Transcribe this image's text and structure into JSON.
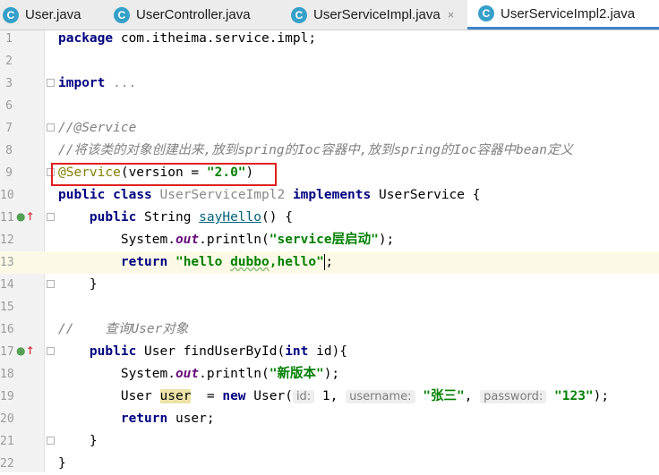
{
  "tabs": [
    {
      "icon": "C",
      "label": "User.java",
      "active": false
    },
    {
      "icon": "C",
      "label": "UserController.java",
      "active": false
    },
    {
      "icon": "C",
      "label": "UserServiceImpl.java",
      "active": false
    },
    {
      "icon": "C",
      "label": "UserServiceImpl2.java",
      "active": true
    }
  ],
  "tab_close_glyph": "×",
  "line_numbers": [
    "1",
    "2",
    "3",
    "6",
    "7",
    "8",
    "9",
    "10",
    "11",
    "12",
    "13",
    "14",
    "15",
    "16",
    "17",
    "18",
    "19",
    "20",
    "21",
    "22"
  ],
  "code": {
    "l1": {
      "kw": "package",
      "rest": " com.itheima.service.impl;"
    },
    "l3": {
      "kw": "import",
      "rest": " ..."
    },
    "l7": "//@Service",
    "l8": "//将该类的对象创建出来,放到spring的Ioc容器中,放到spring的Ioc容器中bean定义",
    "l9": {
      "ann": "@Service",
      "open": "(version = ",
      "str": "\"2.0\"",
      "close": ")"
    },
    "l10": {
      "kw1": "public",
      "kw2": "class",
      "name": "UserServiceImpl2",
      "kw3": "implements",
      "rest": " UserService {"
    },
    "l11": {
      "kw": "public",
      "type": " String ",
      "method": "sayHello",
      "rest": "() {"
    },
    "l12": {
      "obj": "System.",
      "field": "out",
      "call": ".println(",
      "str": "\"service层启动\"",
      "end": ");"
    },
    "l13": {
      "kw": "return",
      "str_a": "\"hello ",
      "str_typo": "dubbo",
      "str_b": ",hello\"",
      "end": ";"
    },
    "l14": "}",
    "l16": {
      "slashes": "//",
      "text": "    查询User对象"
    },
    "l17": {
      "kw": "public",
      "rest1": " User findUserById(",
      "kw2": "int",
      "rest2": " id){"
    },
    "l18": {
      "obj": "System.",
      "field": "out",
      "call": ".println(",
      "str": "\"新版本\"",
      "end": ");"
    },
    "l19": {
      "type": "User ",
      "var": "user",
      "mid": "  = ",
      "kw": "new",
      "ctor": " User(",
      "hint1": "id:",
      "val1": " 1,",
      "hint2": "username:",
      "val2": "\"张三\"",
      "comma": ",",
      "hint3": "password:",
      "val3": "\"123\"",
      "end": ");"
    },
    "l20": {
      "kw": "return",
      "rest": " user;"
    },
    "l21": "}",
    "l22": "}"
  }
}
